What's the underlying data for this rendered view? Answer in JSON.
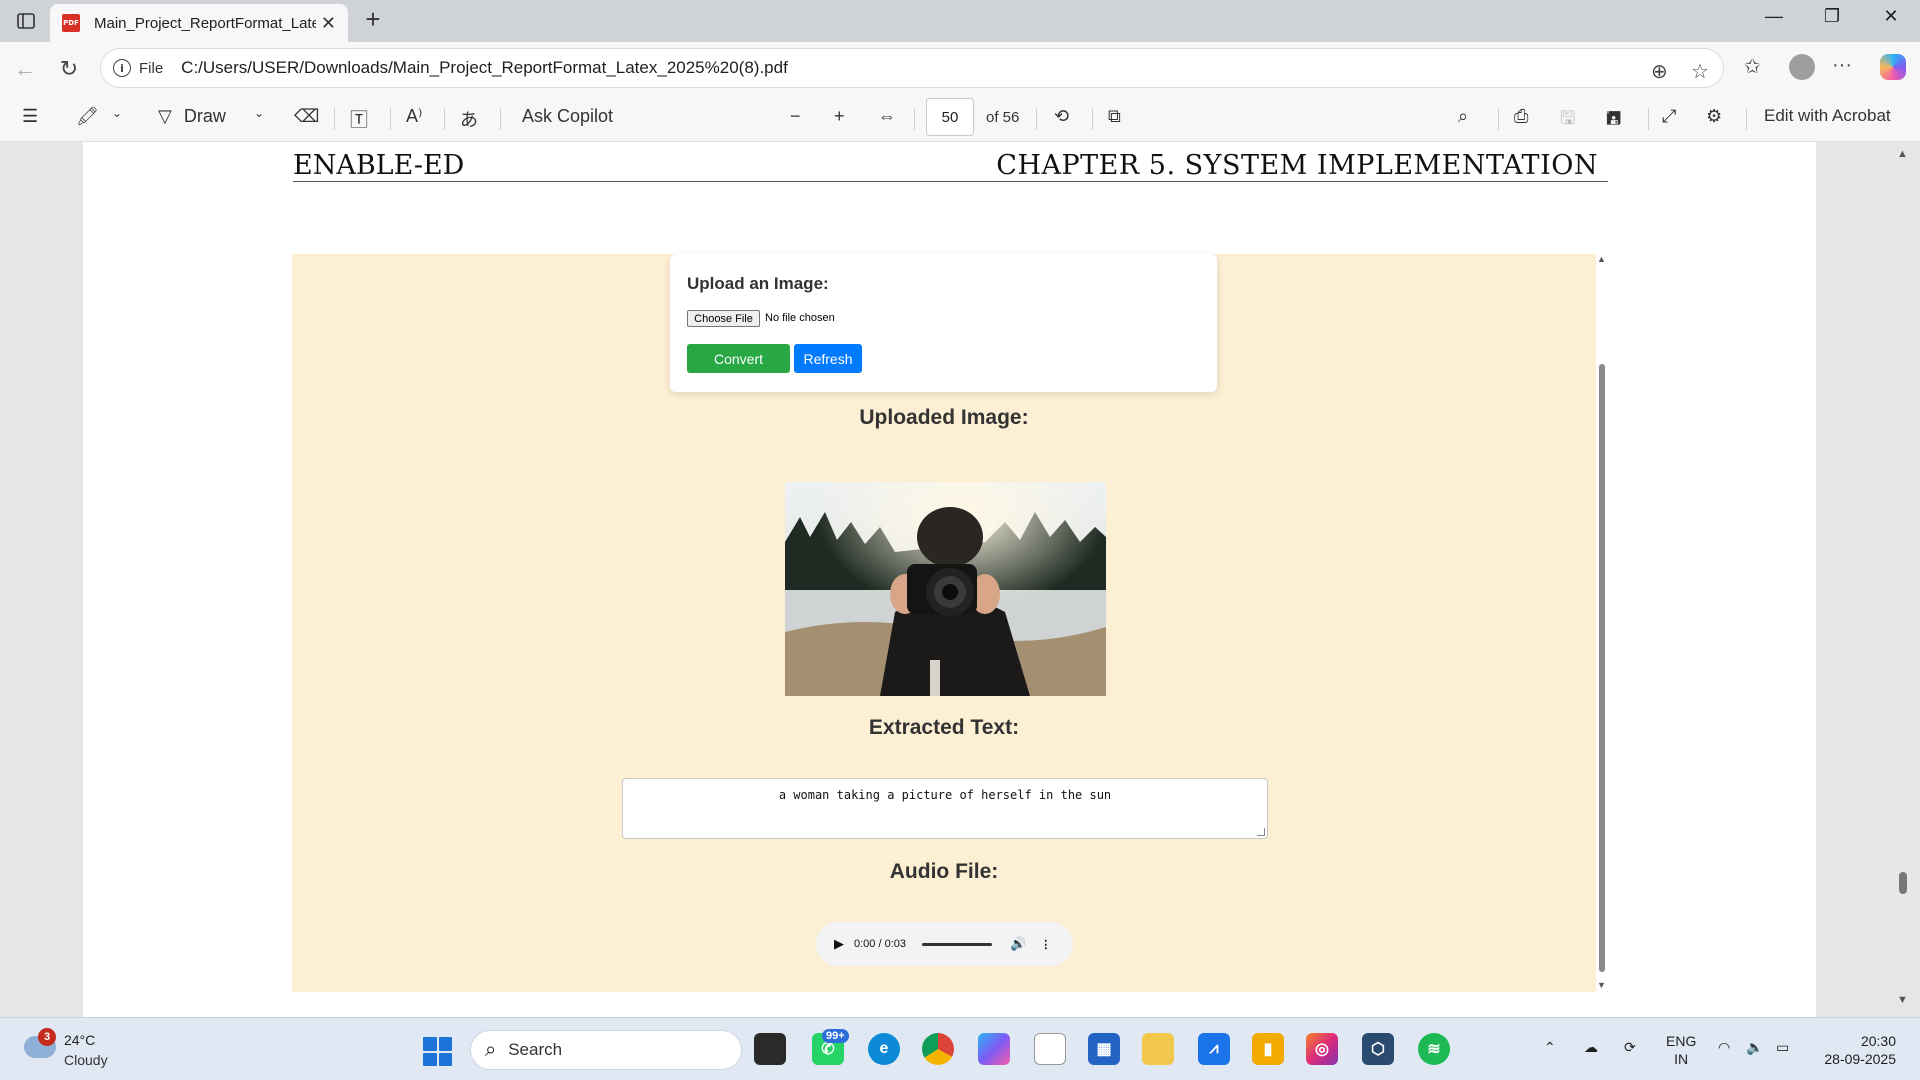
{
  "browser": {
    "tab_title": "Main_Project_ReportFormat_Latex_2025%20(8).pdf",
    "pdf_badge": "PDF",
    "address_label": "File",
    "url": "C:/Users/USER/Downloads/Main_Project_ReportFormat_Latex_2025%20(8).pdf"
  },
  "pdf_toolbar": {
    "draw_label": "Draw",
    "ask_copilot_label": "Ask Copilot",
    "current_page": "50",
    "page_total": "of 56",
    "edit_acrobat_label": "Edit with Acrobat"
  },
  "document": {
    "header_left": "ENABLE-ED",
    "header_right": "CHAPTER 5.   SYSTEM IMPLEMENTATION"
  },
  "screenshot": {
    "upload_label": "Upload an Image:",
    "choose_file_label": "Choose File",
    "no_file_text": "No file chosen",
    "convert_label": "Convert",
    "refresh_label": "Refresh",
    "uploaded_image_title": "Uploaded Image:",
    "extracted_text_title": "Extracted Text:",
    "extracted_text": "a woman taking a picture of herself in the sun",
    "audio_title": "Audio File:",
    "audio_time": "0:00 / 0:03"
  },
  "taskbar": {
    "weather_badge": "3",
    "temperature": "24°C",
    "condition": "Cloudy",
    "search_label": "Search",
    "whatsapp_badge": "99+",
    "lang_top": "ENG",
    "lang_bottom": "IN",
    "time": "20:30",
    "date": "28-09-2025"
  },
  "colors": {
    "convert_green": "#28a745",
    "refresh_blue": "#007bff",
    "screenshot_bg": "#fdefd3"
  }
}
